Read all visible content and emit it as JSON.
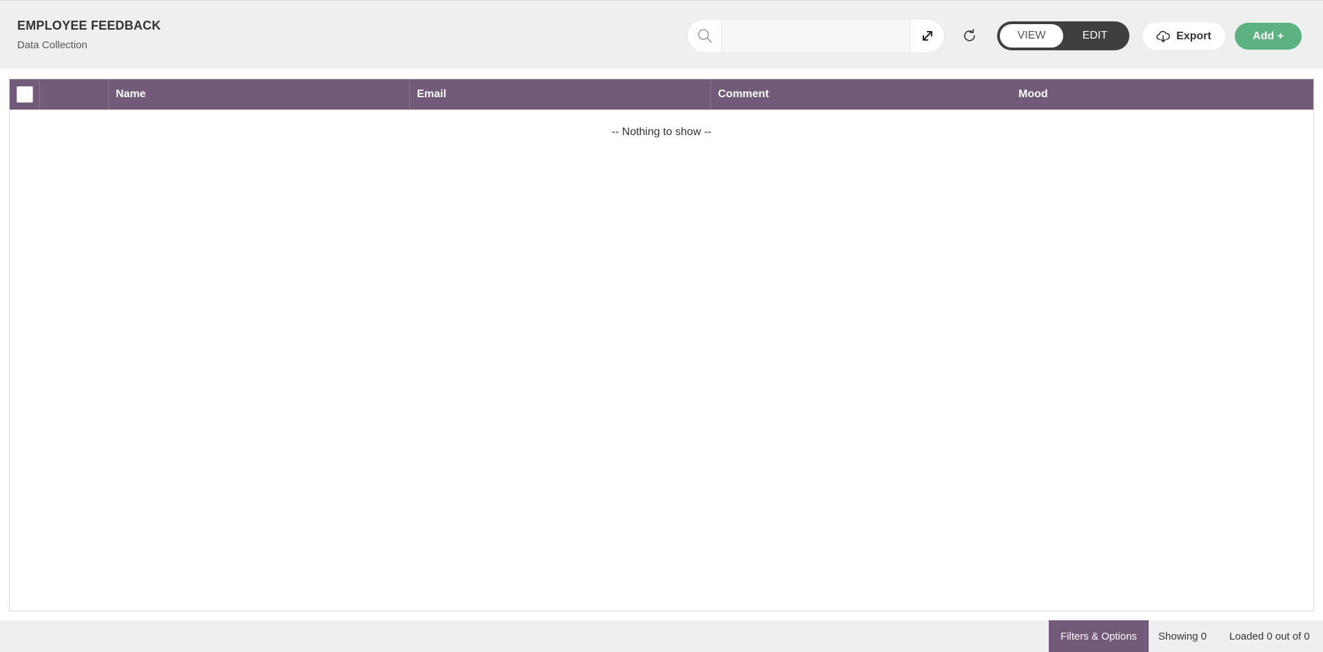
{
  "header": {
    "title": "EMPLOYEE FEEDBACK",
    "subtitle": "Data Collection"
  },
  "search": {
    "placeholder": "",
    "value": "",
    "icon": "search-icon",
    "expand_icon": "expand-icon"
  },
  "toolbar": {
    "refresh_icon": "refresh-icon",
    "mode": {
      "view_label": "VIEW",
      "edit_label": "EDIT",
      "active": "VIEW"
    },
    "export_label": "Export",
    "export_icon": "cloud-download-icon",
    "add_label": "Add +"
  },
  "table": {
    "columns": [
      "Name",
      "Email",
      "Comment",
      "Mood"
    ],
    "rows": [],
    "empty_message": "-- Nothing to show --"
  },
  "footer": {
    "filters_label": "Filters & Options",
    "showing_text": "Showing 0",
    "loaded_text": "Loaded 0 out of 0"
  },
  "colors": {
    "header_bg": "#735a7a",
    "accent_green": "#5cb281",
    "toggle_bg": "#3f3f3f",
    "topbar_bg": "#efefef"
  }
}
